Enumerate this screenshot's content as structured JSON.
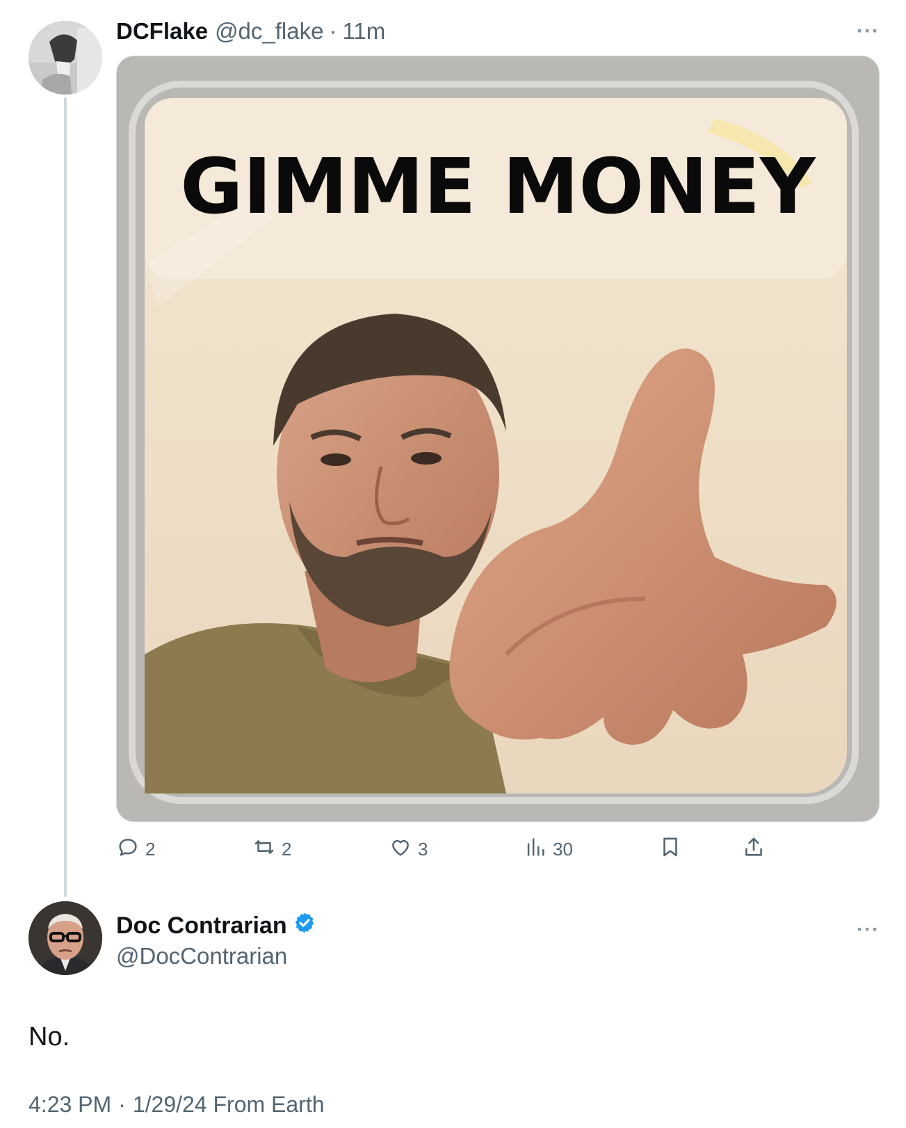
{
  "parent_tweet": {
    "display_name": "DCFlake",
    "handle": "@dc_flake",
    "separator": "·",
    "age": "11m",
    "more": "···",
    "media": {
      "caption_text": "GIMME MONEY"
    },
    "stats": {
      "replies": "2",
      "reposts": "2",
      "likes": "3",
      "views": "30"
    }
  },
  "reply_tweet": {
    "display_name": "Doc Contrarian",
    "handle": "@DocContrarian",
    "more": "···",
    "text": "No.",
    "time": "4:23 PM",
    "separator": "·",
    "date_source": "1/29/24 From Earth"
  },
  "colors": {
    "verified": "#1d9bf0",
    "muted_text": "#536471",
    "primary_text": "#0f1419",
    "thread_line": "#cfd9de"
  },
  "icons": {
    "reply": "speech-bubble-icon",
    "repost": "repost-arrows-icon",
    "like": "heart-icon",
    "views": "bar-chart-icon",
    "bookmark": "bookmark-icon",
    "share": "share-upload-icon",
    "verified": "verified-badge-icon"
  }
}
